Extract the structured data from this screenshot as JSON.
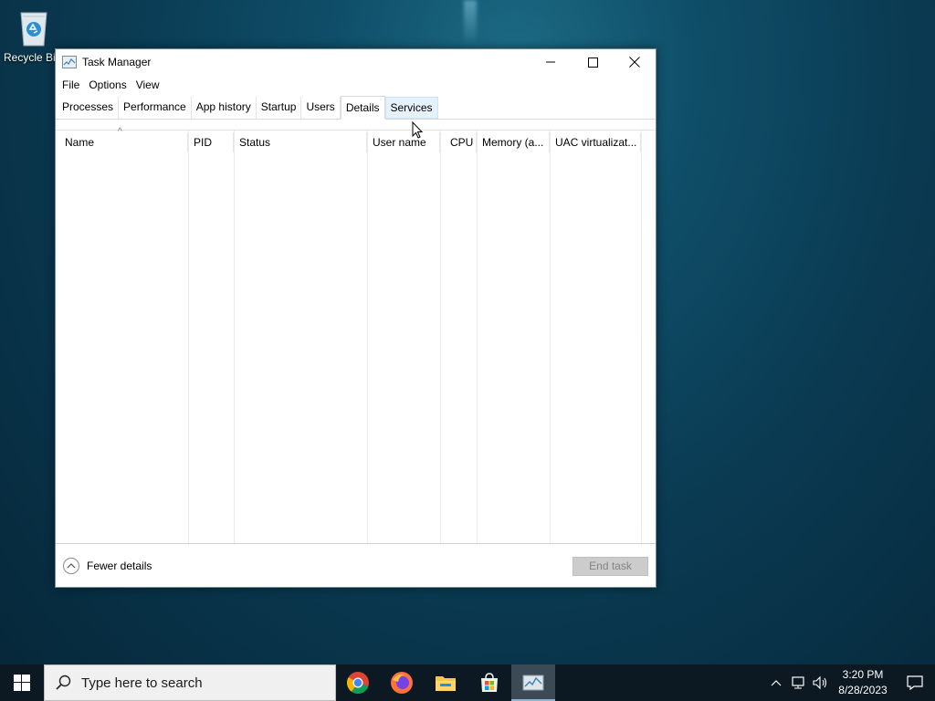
{
  "desktop": {
    "recycle_bin_label": "Recycle Bin"
  },
  "window": {
    "title": "Task Manager",
    "menu": [
      "File",
      "Options",
      "View"
    ],
    "tabs": [
      "Processes",
      "Performance",
      "App history",
      "Startup",
      "Users",
      "Details",
      "Services"
    ],
    "active_tab": "Details",
    "hover_tab": "Services",
    "columns": [
      "Name",
      "PID",
      "Status",
      "User name",
      "CPU",
      "Memory (a...",
      "UAC virtualizat..."
    ],
    "sort_indicator": "^",
    "fewer_details_label": "Fewer details",
    "end_task_label": "End task"
  },
  "taskbar": {
    "search_placeholder": "Type here to search",
    "apps": [
      "chrome-icon",
      "firefox-icon",
      "file-explorer-icon",
      "microsoft-store-icon",
      "task-manager-icon"
    ],
    "clock_time": "3:20 PM",
    "clock_date": "8/28/2023"
  },
  "colors": {
    "accent": "#0078d7",
    "taskbar": "#0c1822",
    "end_task_disabled": "#cccccc"
  }
}
